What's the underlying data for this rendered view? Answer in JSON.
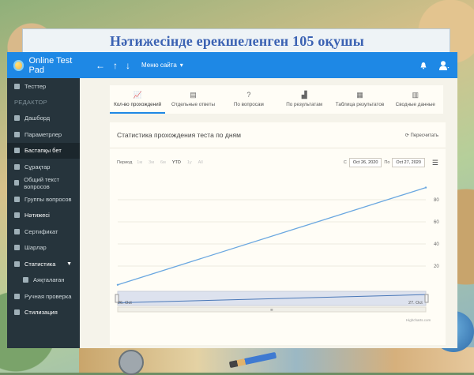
{
  "background": {
    "slide_title": "Нәтижесінде ерекшеленген 105 оқушы"
  },
  "header": {
    "brand": "Online Test Pad",
    "site_menu": "Меню сайта",
    "accent_color": "#1e88e5"
  },
  "sidebar": {
    "items": [
      {
        "label": "Тесттер",
        "icon": "list-icon"
      },
      {
        "section": "РЕДАКТОР"
      },
      {
        "label": "Дашборд",
        "icon": "dashboard-icon"
      },
      {
        "label": "Параметрлер",
        "icon": "gear-icon"
      },
      {
        "label": "Бастапқы бет",
        "icon": "page-icon",
        "active": true
      },
      {
        "label": "Сұрақтар",
        "icon": "question-icon"
      },
      {
        "label": "Общий текст вопросов",
        "icon": "text-icon"
      },
      {
        "label": "Группы вопросов",
        "icon": "group-icon"
      },
      {
        "label": "Нәтижесі",
        "icon": "result-icon",
        "bright": true
      },
      {
        "label": "Сертификат",
        "icon": "certificate-icon"
      },
      {
        "label": "Шарлар",
        "icon": "condition-icon"
      },
      {
        "label": "Статистика",
        "icon": "stats-icon",
        "bright": true,
        "expanded": true
      },
      {
        "label": "Аяқталаған",
        "icon": "finished-icon",
        "sub": true
      },
      {
        "label": "Ручная проверка",
        "icon": "check-icon"
      },
      {
        "label": "Стилизация",
        "icon": "style-icon",
        "bright": true
      }
    ]
  },
  "tabs": [
    {
      "label": "Кол-во прохождений",
      "icon": "chart-line-icon",
      "glyph": "📈",
      "active": true
    },
    {
      "label": "Отдельные ответы",
      "icon": "book-icon",
      "glyph": "▤"
    },
    {
      "label": "По вопросам",
      "icon": "question-icon",
      "glyph": "?"
    },
    {
      "label": "По результатам",
      "icon": "bar-chart-icon",
      "glyph": "▟"
    },
    {
      "label": "Таблица результатов",
      "icon": "table-icon",
      "glyph": "▦"
    },
    {
      "label": "Сводные данные",
      "icon": "summary-icon",
      "glyph": "▥"
    }
  ],
  "stats": {
    "title": "Статистика прохождения теста по дням",
    "recalc": "Пересчитать",
    "period_label": "Период",
    "ranges": [
      {
        "label": "1м",
        "on": false
      },
      {
        "label": "3м",
        "on": false
      },
      {
        "label": "6м",
        "on": false
      },
      {
        "label": "YTD",
        "on": true
      },
      {
        "label": "1y",
        "on": false
      },
      {
        "label": "All",
        "on": false
      }
    ],
    "from_label": "С",
    "from_date": "Oct 26, 2020",
    "to_label": "По",
    "to_date": "Oct 27, 2020"
  },
  "chart_data": {
    "type": "line",
    "x": [
      "26. Oct",
      "27. Oct"
    ],
    "series": [
      {
        "values": [
          3,
          91
        ]
      }
    ],
    "ylim": [
      0,
      100
    ],
    "yticks": [
      20,
      40,
      60,
      80
    ],
    "navigator": {
      "start_label": "26. Oct",
      "end_label": "27. Oct",
      "values": [
        2,
        8
      ]
    },
    "credits": "Highcharts.com",
    "grid": true,
    "line_color": "#6aa7e0"
  }
}
